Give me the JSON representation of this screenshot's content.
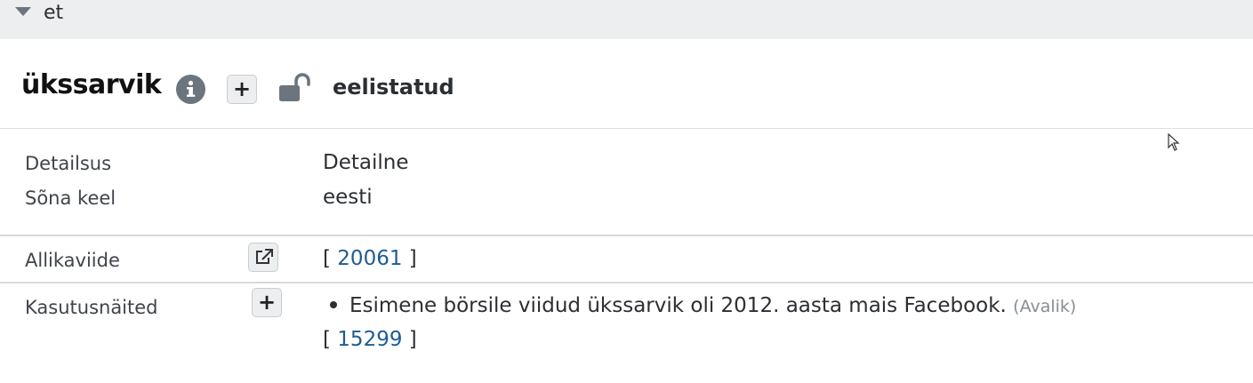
{
  "language_section": {
    "label": "et",
    "toggle_icon": "caret-down-icon"
  },
  "word": {
    "title": "ükssarvik",
    "preferred_label": "eelistatud",
    "info_icon": "info-circle-icon",
    "add_button_label": "+",
    "lock_icon": "unlock-icon"
  },
  "properties": [
    {
      "label": "Detailsus",
      "value": "Detailne"
    },
    {
      "label": "Sõna keel",
      "value": "eesti"
    }
  ],
  "source": {
    "label": "Allikaviide",
    "bracket_open": "[",
    "ref": "20061",
    "bracket_close": "]",
    "external_icon": "external-link-icon"
  },
  "usage": {
    "label": "Kasutusnäited",
    "add_button_label": "+",
    "example_text": "Esimene börsile viidud ükssarvik oli 2012. aasta mais Facebook.",
    "visibility": "(Avalik)",
    "bracket_open": "[",
    "ref": "15299",
    "bracket_close": "]"
  },
  "colors": {
    "header_bg": "#eceeef",
    "link": "#1f5b93",
    "muted": "#868e96"
  }
}
